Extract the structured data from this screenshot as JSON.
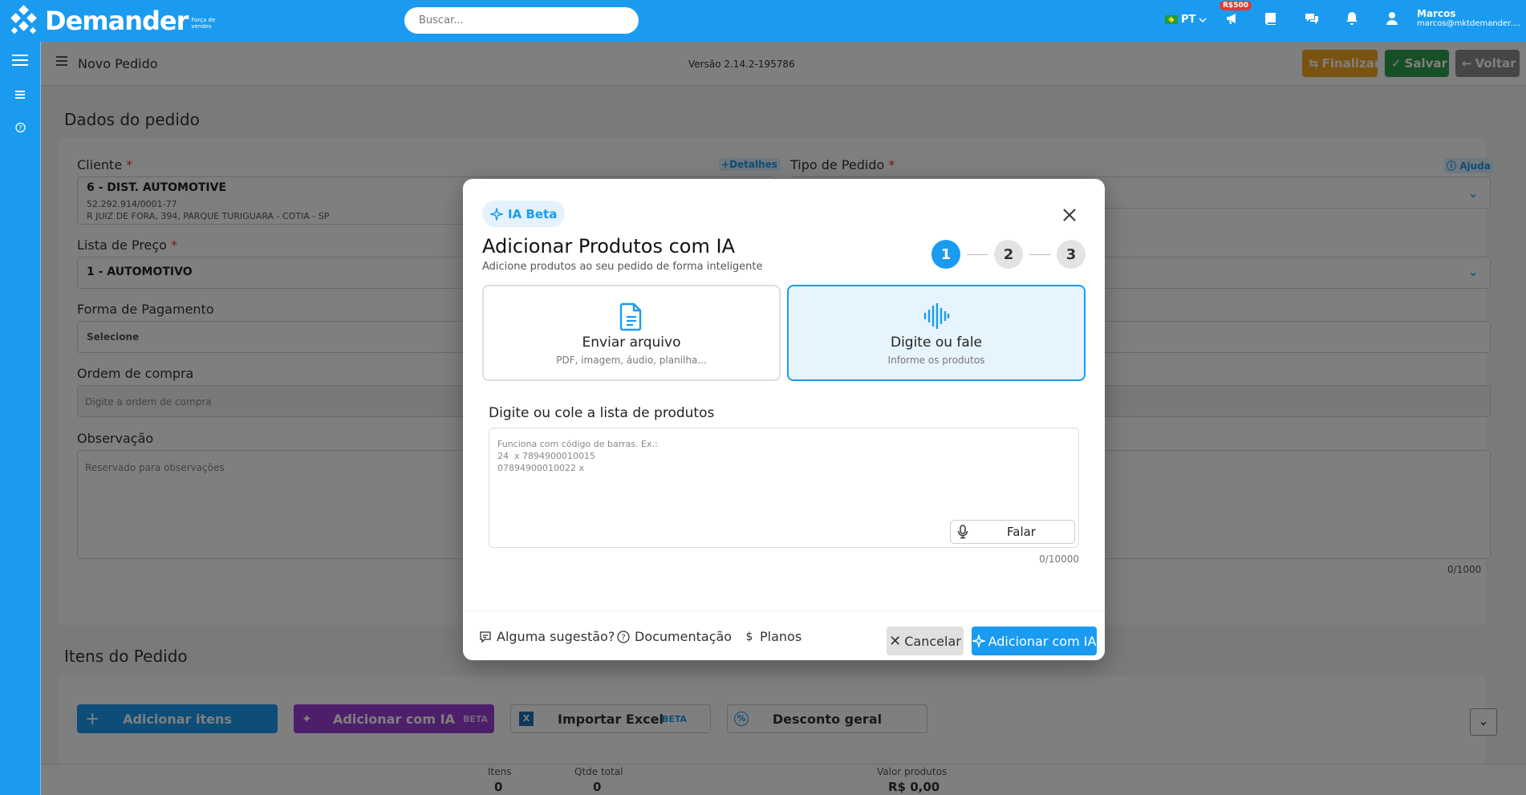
{
  "topbar": {
    "logo_text": "Demander",
    "logo_sub": "Força de vendes",
    "search_placeholder": "Buscar...",
    "lang": "PT",
    "badge": "R$500",
    "user_name": "Marcos",
    "user_email": "marcos@mktdemander...."
  },
  "header": {
    "title": "Novo Pedido",
    "version": "Versão 2.14.2-195786",
    "finalizar": "Finalizar",
    "salvar": "Salvar",
    "voltar": "Voltar"
  },
  "order": {
    "section_title": "Dados do pedido",
    "cliente_label": "Cliente",
    "detalhes_link": "Detalhes",
    "cliente_name": "6 - DIST. AUTOMOTIVE",
    "cliente_cnpj": "52.292.914/0001-77",
    "cliente_address": "R JUIZ DE FORA, 394, PARQUE TURIGUARA - COTIA - SP",
    "tipo_label": "Tipo de Pedido",
    "ajuda_link": "Ajuda",
    "lista_label": "Lista de Preço",
    "lista_value": "1 - AUTOMOTIVO",
    "forma_label": "Forma de Pagamento",
    "forma_value": "Selecione",
    "ordem_label": "Ordem de compra",
    "ordem_placeholder": "Digite a ordem de compra",
    "obs_label": "Observação",
    "obs_placeholder": "Reservado para observações",
    "obs_counter": "0/1000",
    "required_mark": "*"
  },
  "items": {
    "section_title": "Itens do Pedido",
    "add_items": "Adicionar itens",
    "add_ai": "Adicionar com IA",
    "beta": "BETA",
    "import_excel": "Importar Excel",
    "discount": "Desconto geral"
  },
  "footer": {
    "itens_label": "Itens",
    "itens_value": "0",
    "qtde_label": "Qtde total",
    "qtde_value": "0",
    "valor_label": "Valor produtos",
    "valor_value": "R$ 0,00"
  },
  "modal": {
    "chip": "IA Beta",
    "title": "Adicionar Produtos com IA",
    "subtitle": "Adicione produtos ao seu pedido de forma inteligente",
    "steps": [
      "1",
      "2",
      "3"
    ],
    "option_file_title": "Enviar arquivo",
    "option_file_sub": "PDF, imagem, áudio, planilha...",
    "option_text_title": "Digite ou fale",
    "option_text_sub": "Informe os produtos",
    "input_label": "Digite ou cole a lista de produtos",
    "textarea_placeholder": "Funciona com código de barras. Ex.:\n24  x 7894900010015\n07894900010022 x",
    "falar": "Falar",
    "counter": "0/10000",
    "suggestion": "Alguma sugestão?",
    "docs": "Documentação",
    "plans": "Planos",
    "cancel": "Cancelar",
    "submit": "Adicionar com IA"
  },
  "colors": {
    "primary": "#1a9bf0",
    "finalizar": "#f5a623",
    "salvar": "#2e9e4f",
    "voltar": "#8c8c8c",
    "ai_purple": "#9b3fd6"
  }
}
